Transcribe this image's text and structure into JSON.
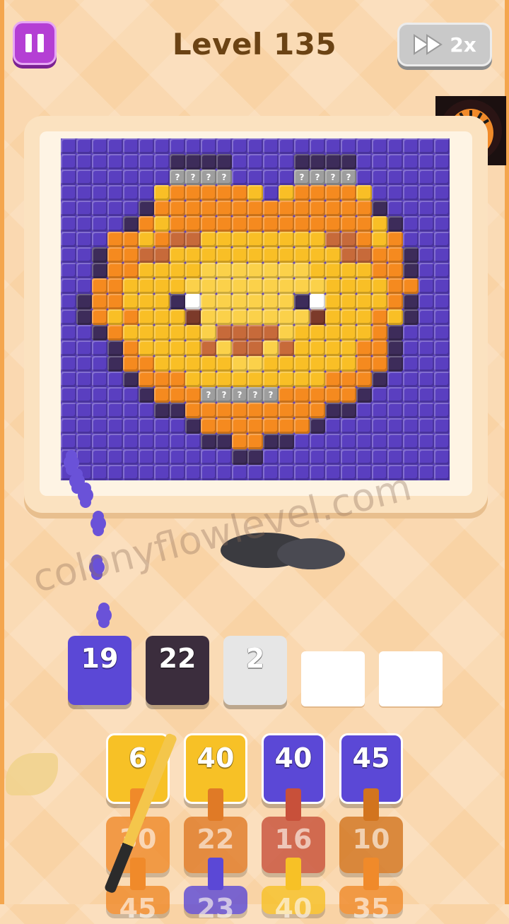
{
  "header": {
    "title": "Level 135",
    "speed_label": "2x"
  },
  "board": {
    "cols": 25,
    "rows": 22,
    "palette": {
      "B": "#5a3fc0",
      "D": "#3d2c5a",
      "O": "#f58a1f",
      "Y": "#f9bf26",
      "L": "#fbd14a",
      "R": "#c76a3a",
      "N": "#7c3a2a",
      "W": "#ffffff",
      "Q": "#9e9e9e"
    },
    "pixels": [
      "BBBBBBBBBBBBBBBBBBBBBBBBB",
      "BBBBBBBDDDDBBBBDDDDBBBBBB",
      "BBBBBBBQQQQBBBBQQQQBBBBBB",
      "BBBBBBYOOOOOYBYOOOOYBBBBB",
      "BBBBBDOOOOOOOOOOOOOODBBBB",
      "BBBBDOYOOOOOOOOOOOOOYDBBB",
      "BBBOOYORRYYYYYYYYRROYOBBB",
      "BBDOORRYYYYYYYYYYYRROODBB",
      "BBDOOYYYYLLLLLLLYYYYOODBB",
      "BBOOYYYYLLLLLLLLLYYYYOOBB",
      "BDOOYYYDWLLLLLLDWYYYYODBB",
      "BDOYOYYYNLLLLLLLNYYYOYDBB",
      "BBDOYYYYYLRRRRLYYYYYODBBB",
      "BBBDOYYYYRLRRLRYYYYOODBBB",
      "BBBDOOYYYYYLLYYYYYYOODBBB",
      "BBBBDOOOYYYYYYYYYOOODBBBB",
      "BBBBBDOOOQQQQQOOOOODBBBBB",
      "BBBBBBDDOOOOOOOOODDBBBBBB",
      "BBBBBBBBDOOOOOOODBBBBBBBB",
      "BBBBBBBBBDDOODDBBBBBBBBBB",
      "BBBBBBBBBBBDDBBBBBBBBBBBB",
      "BBBBBBBBBBBBBBBBBBBBBBBBB"
    ],
    "hidden_mark": "?"
  },
  "watermark": "colonyflowlevel.com",
  "queue": [
    {
      "value": "19",
      "color": "#5b48d6"
    },
    {
      "value": "22",
      "color": "#3b2d3d"
    },
    {
      "value": "2",
      "color": "#e6e6e6"
    },
    {
      "value": "",
      "color": "#ffffff"
    },
    {
      "value": "",
      "color": "#ffffff"
    }
  ],
  "tiles_row1": [
    {
      "value": "6",
      "color": "#f7c126"
    },
    {
      "value": "40",
      "color": "#f7c126"
    },
    {
      "value": "40",
      "color": "#5b48d6"
    },
    {
      "value": "45",
      "color": "#5b48d6"
    }
  ],
  "tiles_row2": [
    {
      "value": "30",
      "color": "#f08a2a"
    },
    {
      "value": "22",
      "color": "#e07a26"
    },
    {
      "value": "16",
      "color": "#c8503a"
    },
    {
      "value": "10",
      "color": "#d2741e"
    }
  ],
  "tiles_row3": [
    {
      "value": "45",
      "color": "#f08a2a"
    },
    {
      "value": "23",
      "color": "#5b48d6"
    },
    {
      "value": "40",
      "color": "#f7c126"
    },
    {
      "value": "35",
      "color": "#f08a2a"
    }
  ]
}
